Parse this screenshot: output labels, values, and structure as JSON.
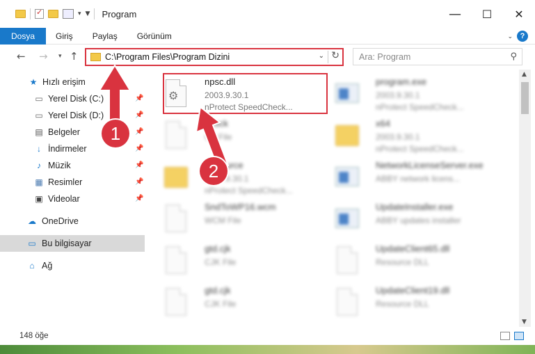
{
  "window": {
    "title": "Program"
  },
  "ribbon": {
    "tabs": [
      {
        "label": "Dosya",
        "active": true
      },
      {
        "label": "Giriş",
        "active": false
      },
      {
        "label": "Paylaş",
        "active": false
      },
      {
        "label": "Görünüm",
        "active": false
      }
    ],
    "help_label": "?"
  },
  "address": {
    "path": "C:\\Program Files\\Program Dizini"
  },
  "search": {
    "placeholder": "Ara: Program"
  },
  "sidebar": {
    "items": [
      {
        "label": "Hızlı erişim",
        "icon": "star-icon"
      },
      {
        "label": "Yerel Disk (C:)",
        "icon": "drive-icon",
        "pinned": true
      },
      {
        "label": "Yerel Disk (D:)",
        "icon": "drive-icon",
        "pinned": true
      },
      {
        "label": "Belgeler",
        "icon": "documents-icon",
        "pinned": true
      },
      {
        "label": "İndirmeler",
        "icon": "download-icon",
        "pinned": true
      },
      {
        "label": "Müzik",
        "icon": "music-icon",
        "pinned": true
      },
      {
        "label": "Resimler",
        "icon": "pictures-icon",
        "pinned": true
      },
      {
        "label": "Videolar",
        "icon": "videos-icon",
        "pinned": true
      },
      {
        "label": "OneDrive",
        "icon": "cloud-icon"
      },
      {
        "label": "Bu bilgisayar",
        "icon": "computer-icon",
        "selected": true
      },
      {
        "label": "Ağ",
        "icon": "network-icon"
      }
    ]
  },
  "files": {
    "left": [
      {
        "name": "npsc.dll",
        "line1": "2003.9.30.1",
        "line2": "nProtect SpeedCheck...",
        "type": "dll",
        "highlighted": true
      },
      {
        "name": "npsck",
        "line1": "CK File",
        "line2": "",
        "type": "doc"
      },
      {
        "name": "Resource",
        "line1": "2003.9.30.1",
        "line2": "nProtect SpeedCheck...",
        "type": "folder"
      },
      {
        "name": "SndToWP16.wcm",
        "line1": "WCM File",
        "line2": "",
        "type": "doc"
      },
      {
        "name": "gtd.cjk",
        "line1": "CJK File",
        "line2": "",
        "type": "doc"
      },
      {
        "name": "gtd.cjk",
        "line1": "CJK File",
        "line2": "",
        "type": "doc"
      }
    ],
    "right": [
      {
        "name": "program.exe",
        "line1": "2003.9.30.1",
        "line2": "nProtect SpeedCheck...",
        "type": "exe"
      },
      {
        "name": "x64",
        "line1": "2003.9.30.1",
        "line2": "nProtect SpeedCheck...",
        "type": "folder"
      },
      {
        "name": "NetworkLicenseServer.exe",
        "line1": "ABBY network licens...",
        "line2": "",
        "type": "exe"
      },
      {
        "name": "UpdateInstaller.exe",
        "line1": "ABBY updates installer",
        "line2": "",
        "type": "exe"
      },
      {
        "name": "UpdateClient65.dll",
        "line1": "Resource DLL",
        "line2": "",
        "type": "doc"
      },
      {
        "name": "UpdateClient19.dll",
        "line1": "Resource DLL",
        "line2": "",
        "type": "doc"
      }
    ]
  },
  "status": {
    "count": "148 öğe"
  },
  "annotations": {
    "badge1": "1",
    "badge2": "2",
    "color": "#d9333f"
  },
  "colors": {
    "accent": "#1979ca",
    "highlight": "#d9333f",
    "folder": "#f3c948"
  }
}
